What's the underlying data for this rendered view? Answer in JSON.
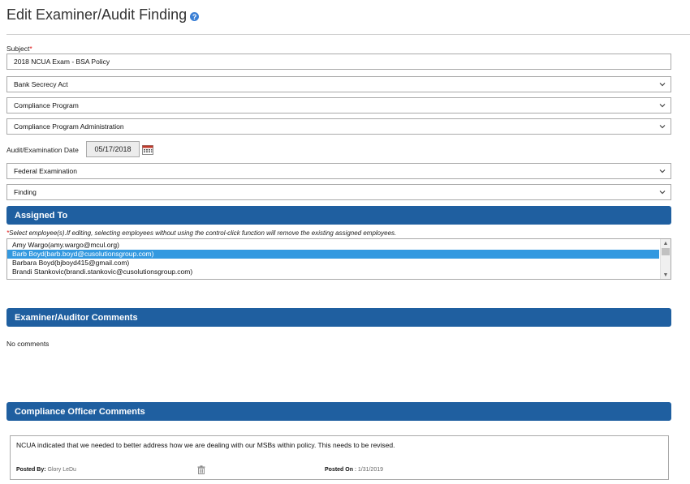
{
  "page": {
    "title": "Edit Examiner/Audit Finding",
    "help_icon": "question-circle-icon",
    "help_glyph": "?"
  },
  "form": {
    "subject_label": "Subject",
    "required_mark": "*",
    "subject_value": "2018 NCUA Exam - BSA Policy",
    "category": "Bank Secrecy Act",
    "subcategory": "Compliance Program",
    "topic": "Compliance Program Administration",
    "date_label": "Audit/Examination Date",
    "date_value": "05/17/2018",
    "exam_type": "Federal Examination",
    "finding_type": "Finding"
  },
  "assigned": {
    "header": "Assigned To",
    "note_mark": "*",
    "note": "Select employee(s).If editing, selecting employees without using the control-click function will remove the existing assigned employees.",
    "employees": [
      {
        "label": "Amy Wargo(amy.wargo@mcul.org)",
        "selected": false
      },
      {
        "label": "Barb Boyd(barb.boyd@cusolutionsgroup.com)",
        "selected": true
      },
      {
        "label": "Barbara Boyd(bjboyd415@gmail.com)",
        "selected": false
      },
      {
        "label": "Brandi Stankovic(brandi.stankovic@cusolutionsgroup.com)",
        "selected": false
      }
    ]
  },
  "examiner_comments": {
    "header": "Examiner/Auditor Comments",
    "empty_text": "No comments"
  },
  "officer_comments": {
    "header": "Compliance Officer Comments",
    "comment_text": "NCUA indicated that we needed to better address how we are dealing with our MSBs within policy. This needs to be revised.",
    "posted_by_label": "Posted By",
    "posted_by_value": "Glory LeDu",
    "posted_on_label": "Posted On",
    "posted_on_value": "1/31/2019"
  },
  "colors": {
    "section_header_bg": "#1f5fa0",
    "selection_bg": "#3399e0",
    "help_icon": "#3a7fd5",
    "required": "#dd1111"
  }
}
